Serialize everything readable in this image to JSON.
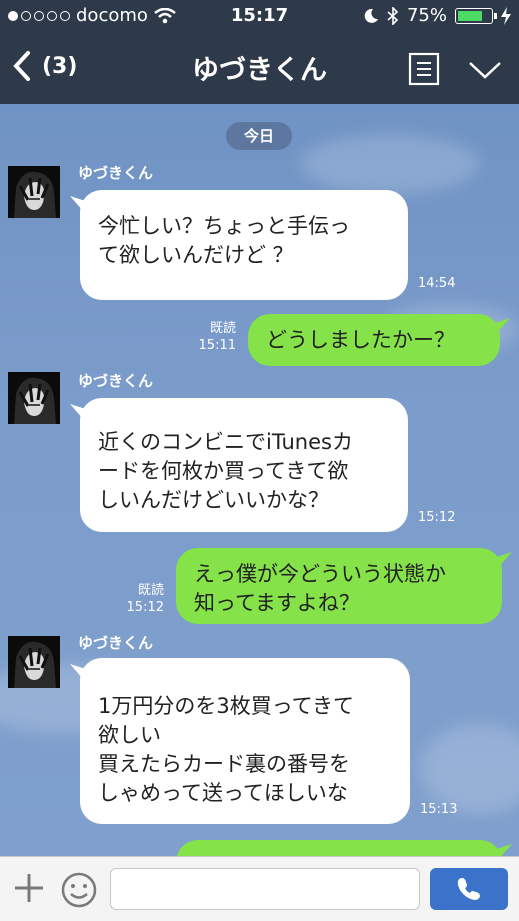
{
  "status": {
    "carrier": "docomo",
    "signal_bars": 1,
    "time": "15:17",
    "battery_pct": "75%",
    "icons": [
      "signal-dots-icon",
      "wifi-icon",
      "moon-icon",
      "bluetooth-icon",
      "battery-icon",
      "charging-icon"
    ]
  },
  "header": {
    "back_count": "(3)",
    "title": "ゆづきくん",
    "icons": [
      "back-chevron-icon",
      "menu-list-icon",
      "chevron-down-icon"
    ]
  },
  "chat": {
    "date_label": "今日",
    "messages": [
      {
        "from": "them",
        "sender": "ゆづきくん",
        "text": "今忙しい？ちょっと手伝っ\nて欲しいんだけど ？",
        "time": "14:54"
      },
      {
        "from": "me",
        "text": "どうしましたかー？",
        "read": "既読",
        "time": "15:11"
      },
      {
        "from": "them",
        "sender": "ゆづきくん",
        "text": "近くのコンビニでiTunesカ\nードを何枚か買ってきて欲\nしいんだけどいいかな？",
        "time": "15:12"
      },
      {
        "from": "me",
        "text": "えっ僕が今どういう状態か\n知ってますよね？",
        "read": "既読",
        "time": "15:12"
      },
      {
        "from": "them",
        "sender": "ゆづきくん",
        "text": "1万円分のを3枚買ってきて\n欲しい\n買えたらカード裏の番号を\nしゃめって送ってほしいな",
        "time": "15:13"
      },
      {
        "from": "me",
        "text": "",
        "partial": true
      }
    ]
  },
  "inputbar": {
    "placeholder": "",
    "icons": [
      "plus-icon",
      "smiley-icon",
      "phone-icon"
    ]
  },
  "colors": {
    "header_bg": "#2e3a4a",
    "chat_bg": "#7b9cc7",
    "my_bubble": "#85e249",
    "their_bubble": "#ffffff",
    "call_button": "#3a73c9"
  }
}
